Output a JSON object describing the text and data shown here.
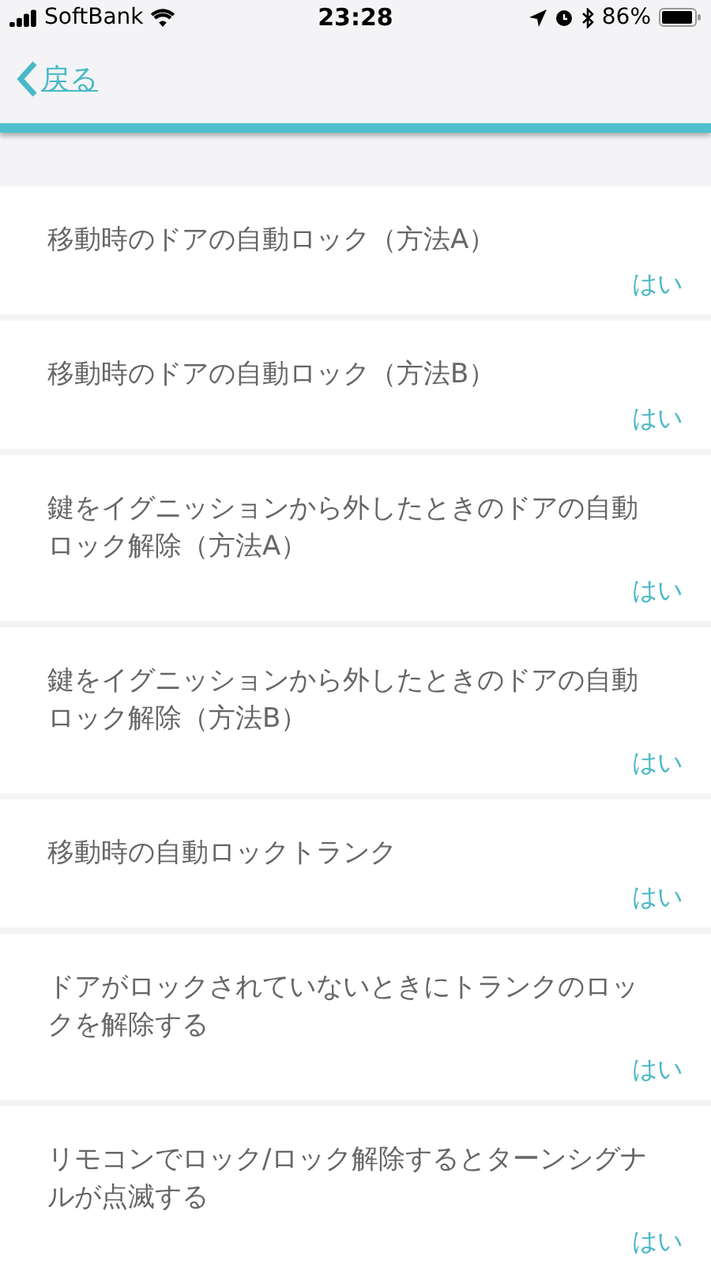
{
  "status_bar": {
    "carrier": "SoftBank",
    "time": "23:28",
    "battery": "86%"
  },
  "nav": {
    "back": "戻る"
  },
  "settings": [
    {
      "label": "移動時のドアの自動ロック（方法A）",
      "value": "はい"
    },
    {
      "label": "移動時のドアの自動ロック（方法B）",
      "value": "はい"
    },
    {
      "label": "鍵をイグニッションから外したときのドアの自動ロック解除（方法A）",
      "value": "はい"
    },
    {
      "label": "鍵をイグニッションから外したときのドアの自動ロック解除（方法B）",
      "value": "はい"
    },
    {
      "label": "移動時の自動ロックトランク",
      "value": "はい"
    },
    {
      "label": "ドアがロックされていないときにトランクのロックを解除する",
      "value": "はい"
    },
    {
      "label": "リモコンでロック/ロック解除するとターンシグナルが点滅する",
      "value": "はい"
    }
  ]
}
